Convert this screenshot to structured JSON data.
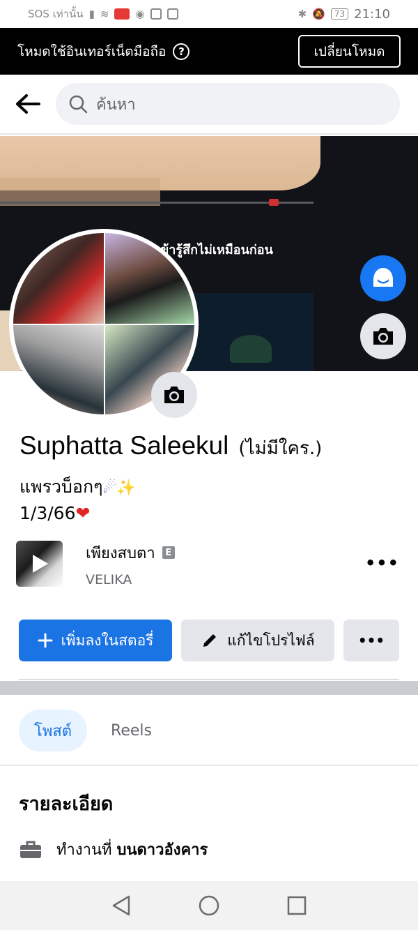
{
  "status_bar": {
    "carrier": "SOS เท่านั้น",
    "time": "21:10",
    "battery": "73"
  },
  "data_mode": {
    "text": "โหมดใช้อินเทอร์เน็ตมือถือ",
    "help": "?",
    "switch_label": "เปลี่ยนโหมด"
  },
  "search": {
    "placeholder": "ค้นหา"
  },
  "cover": {
    "caption": "ข้ารู้สึกไม่เหมือนก่อน"
  },
  "profile": {
    "name": "Suphatta Saleekul",
    "alt_name": "(ไม่มีใคร.)",
    "bio_line1": "แพรวบ็อกๆ",
    "bio_line1_emoji": "☄✨",
    "bio_line2": "1/3/66",
    "bio_line2_emoji": "❤"
  },
  "music": {
    "song": "เพียงสบตา",
    "explicit": "E",
    "artist": "VELIKA",
    "more": "•••"
  },
  "actions": {
    "add_story": "เพิ่มลงในสตอรี่",
    "edit_profile": "แก้ไขโปรไฟล์",
    "more": "•••"
  },
  "tabs": [
    {
      "label": "โพสต์"
    },
    {
      "label": "Reels"
    }
  ],
  "details": {
    "title": "รายละเอียด",
    "work_prefix": "ทำงานที่",
    "work_place": "บนดาวอังคาร"
  },
  "colors": {
    "accent": "#1b74e4",
    "banner": "#000000"
  }
}
